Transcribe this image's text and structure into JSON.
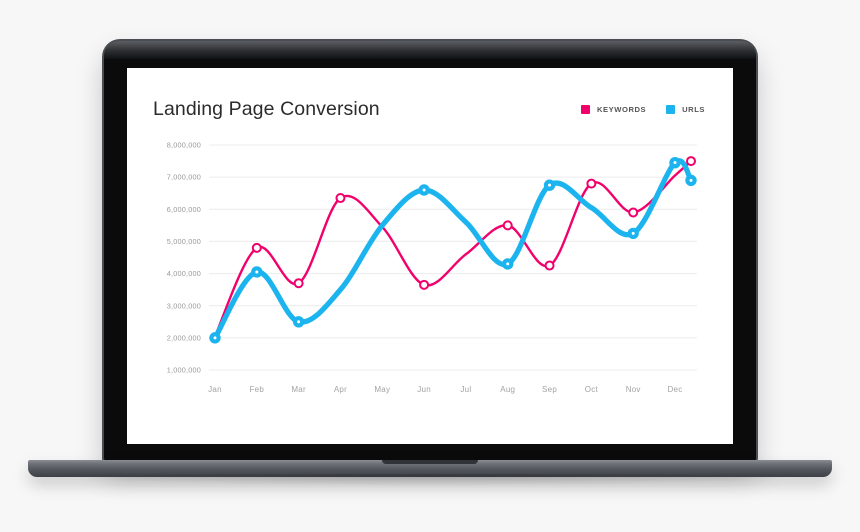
{
  "device": {
    "type": "laptop-mockup",
    "frame_color": "#3c3f45",
    "screen_bg": "#ffffff"
  },
  "card": {
    "title": "Landing Page Conversion"
  },
  "legend": {
    "position": "top-right",
    "items": [
      {
        "label": "KEYWORDS",
        "color": "#F2006B"
      },
      {
        "label": "URLS",
        "color": "#1CB4EE"
      }
    ]
  },
  "chart_data": {
    "type": "line",
    "title": "Landing Page Conversion",
    "xlabel": "",
    "ylabel": "",
    "grid": true,
    "legend_position": "top-right",
    "smoothing": "spline",
    "categories": [
      "Jan",
      "Feb",
      "Mar",
      "Apr",
      "May",
      "Jun",
      "Jul",
      "Aug",
      "Sep",
      "Oct",
      "Nov",
      "Dec"
    ],
    "ytick_labels": [
      "8,000,000",
      "7,000,000",
      "6,000,000",
      "5,000,000",
      "4,000,000",
      "3,000,000",
      "2,000,000",
      "1,000,000"
    ],
    "ytick_values": [
      8000000,
      7000000,
      6000000,
      5000000,
      4000000,
      3000000,
      2000000,
      1000000
    ],
    "ylim": [
      1000000,
      8000000
    ],
    "series": [
      {
        "name": "KEYWORDS",
        "color": "#F2006B",
        "marker": "open-circle",
        "values": [
          2050000,
          4800000,
          3700000,
          6350000,
          5450000,
          3650000,
          4600000,
          5500000,
          4250000,
          6800000,
          5900000,
          7050000
        ],
        "markers_at": [
          "Feb",
          "Mar",
          "Apr",
          "Jun",
          "Aug",
          "Sep",
          "Oct",
          "Nov"
        ],
        "end_point": 7500000
      },
      {
        "name": "URLS",
        "color": "#1CB4EE",
        "marker": "filled-circle",
        "values": [
          2000000,
          4050000,
          2500000,
          3500000,
          5500000,
          6600000,
          5600000,
          4300000,
          6750000,
          6050000,
          5250000,
          7450000
        ],
        "markers_at": [
          "Jan",
          "Feb",
          "Mar",
          "Jun",
          "Aug",
          "Sep",
          "Nov",
          "Dec"
        ],
        "end_point": 6900000
      }
    ]
  }
}
